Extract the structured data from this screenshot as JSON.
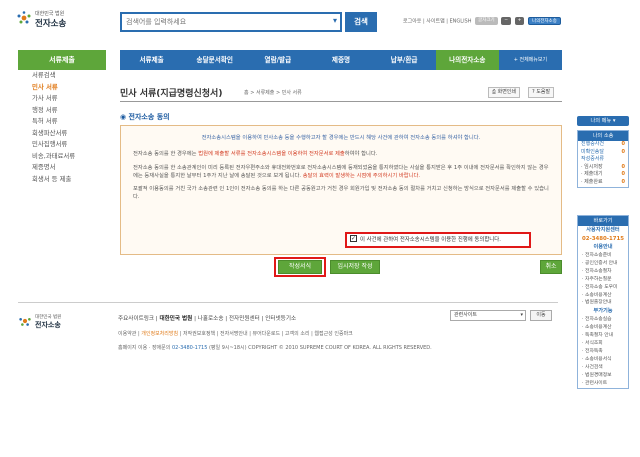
{
  "header": {
    "logo_small": "대한민국 법원",
    "logo_big": "전자소송",
    "search_placeholder": "검색어를 입력하세요",
    "search_button": "검색",
    "toplinks": "로그아웃 | 사이트맵 | ENGLISH",
    "font_label": "글자크기",
    "font_minus": "−",
    "font_plus": "+",
    "my_button": "나의전자소송"
  },
  "leftnav": {
    "title": "서류제출",
    "items": [
      "서류검색",
      "민사 서류",
      "가사 서류",
      "행정 서류",
      "특허 서류",
      "회생파산서류",
      "민사집행서류",
      "비송,과태료서류",
      "제증명서",
      "회생서 등 제출"
    ]
  },
  "topnav": {
    "items": [
      "서류제출",
      "송달문서확인",
      "열람/발급",
      "제증명",
      "납부/환급",
      "나의전자소송",
      "+ 전체메뉴보기"
    ]
  },
  "page": {
    "title": "민사 서류(지급명령신청서)",
    "breadcrumb": "홈 > 서류제출 > 민사 서류",
    "print_label": "화면인쇄",
    "help_label": "도움말"
  },
  "section": {
    "title": "전자소송 동의"
  },
  "notice": {
    "lead": "전자소송시스템을 이용하여 민사소송 등을 수행하고자 할 경우에는 반드시 해당 사건에 관하여 전자소송 동의를 하셔야 합니다.",
    "p1a": "전자소송 동의를 한 경우에는 ",
    "p1b": "법원에 제출할 서류를 전자소송시스템을 이용하여 전자문서로 제출",
    "p1c": "하여야 합니다.",
    "p2a": "전자소송 동의를 한 소송관계인이 미리 등록된 전자우편주소와 휴대전화번호로 전자소송시스템에 등재되었음을 통지하였다는 사실을 통지받은 후 1주 이내에 전자문서를 확인하지 않는 경우에는 등재사실을 통지한 날부터 1주가 지난 날에 송달된 것으로 보게 됩니다. ",
    "p2b": "송달의 효력이 발생하는 시점에 주의하시기 바랍니다.",
    "p3": "포괄적 이용동의를 거친 국가 소송관련 인 1인이 전자소송 동의를 하는 다른 공동원고가 거친 경우 회원가입 및 전자소송 동의 절차를 거치고 신청하는 방식으로 전자문서를 제출할 수 있습니다.",
    "agree_check": "✓",
    "agree_text": "이 사건에 관하여 전자소송시스템을 이용한 진행에 동의합니다."
  },
  "buttons": {
    "write": "작성서식",
    "temp": "임시저장 작성",
    "cancel": "취소"
  },
  "footer": {
    "logo_small": "대한민국 법원",
    "logo_big": "전자소송",
    "links_pre": "주요사이트링크 | ",
    "links_court": "대한민국 법원",
    "links_rest": " | 나홀로소송 | 전자민원센터 | 인터넷등기소",
    "select_label": "관련사이트",
    "go": "이동",
    "row2_pre": "이용약관 | ",
    "row2_hl": "개인정보처리방침",
    "row2_rest": " | 저작권보호정책 | 전자서명안내 | 뷰어다운로드 | 고객의 소리 | 웹접근성 인증마크",
    "row3_pre": "홈페이지 이용 · 장애문의 ",
    "row3_hl": "02-3480-1715",
    "row3_rest": " (평일 9시~18시)   COPYRIGHT © 2010 SUPREME COURT OF KOREA. ALL RIGHTS RESERVED."
  },
  "rightside": {
    "menu": "나의 메뉴 ▾",
    "status_title": "나의 소송",
    "status": [
      {
        "k": "진행중사건",
        "v": "0",
        "plain": false
      },
      {
        "k": "미확인송달",
        "v": "0",
        "plain": false
      },
      {
        "k": "작성중서류",
        "v": "",
        "plain": false
      },
      {
        "k": "· 임시저장",
        "v": "0",
        "plain": true
      },
      {
        "k": "· 제출대기",
        "v": "0",
        "plain": true
      },
      {
        "k": "· 제출완료",
        "v": "0",
        "plain": true
      }
    ],
    "shortcut_title": "바로가기",
    "center": "사용자지원센터",
    "phone": "02-3480-1715",
    "guide": "이용안내",
    "links": [
      "· 전자소송준비",
      "· 공인인증서 안내",
      "· 전자소송절차",
      "· 자주하는질문",
      "· 전자소송 도우미",
      "· 소송비용계산",
      "· 법원출장안내"
    ],
    "faq": "부가기능",
    "links2": [
      "· 전자소송실습",
      "· 소송비용계산",
      "· 독촉절차 안내",
      "· 서식조회",
      "· 전자독촉",
      "· 소송비용서식",
      "· 사건검색",
      "· 법원경매정보",
      "· 관련사이트"
    ]
  }
}
